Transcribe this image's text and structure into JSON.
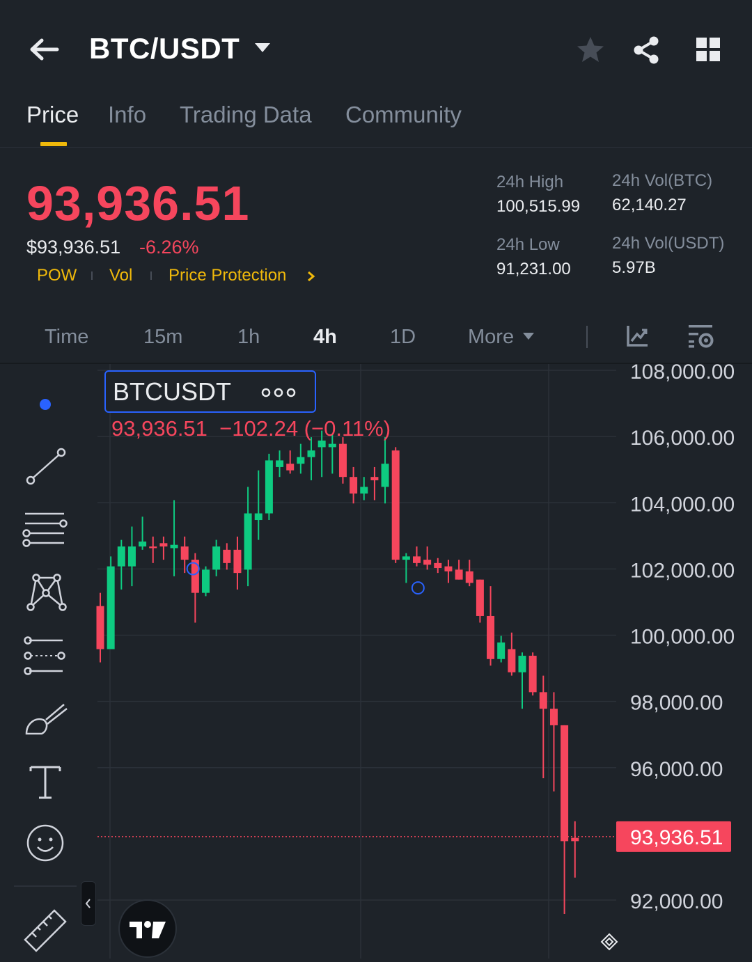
{
  "header": {
    "title": "BTC/USDT"
  },
  "tabs": [
    {
      "label": "Price",
      "active": true
    },
    {
      "label": "Info"
    },
    {
      "label": "Trading Data"
    },
    {
      "label": "Community"
    }
  ],
  "ticker": {
    "last_price": "93,936.51",
    "usd_price": "$93,936.51",
    "change_pct": "-6.26%",
    "tags": [
      "POW",
      "Vol",
      "Price Protection"
    ],
    "stats": {
      "high_label": "24h High",
      "high_value": "100,515.99",
      "low_label": "24h Low",
      "low_value": "91,231.00",
      "vol_btc_label": "24h Vol(BTC)",
      "vol_btc_value": "62,140.27",
      "vol_usdt_label": "24h Vol(USDT)",
      "vol_usdt_value": "5.97B"
    }
  },
  "intervals": [
    "Time",
    "15m",
    "1h",
    "4h",
    "1D",
    "More"
  ],
  "active_interval": "4h",
  "colors": {
    "up": "#0ecb81",
    "down": "#f6465d",
    "accent": "#f0b90b",
    "background": "#1e2329"
  },
  "icons": [
    "back-arrow-icon",
    "caret-down-icon",
    "star-icon",
    "share-icon",
    "grid-icon",
    "indicator-icon",
    "chart-settings-icon"
  ],
  "legend": {
    "symbol": "BTCUSDT",
    "ohlc": "93,936.51  −102.24 (−0.11%)"
  },
  "chart_data": {
    "type": "candlestick",
    "symbol": "BTCUSDT",
    "interval": "4h",
    "ylim": [
      91000,
      108500
    ],
    "y_ticks": [
      "108,000.00",
      "106,000.00",
      "104,000.00",
      "102,000.00",
      "100,000.00",
      "98,000.00",
      "96,000.00",
      "92,000.00"
    ],
    "last_price_label": "93,936.51",
    "last_price": 93936.51,
    "candles": [
      {
        "o": 100900,
        "h": 101300,
        "l": 99200,
        "c": 99600
      },
      {
        "o": 99600,
        "h": 102400,
        "l": 99600,
        "c": 102100
      },
      {
        "o": 102100,
        "h": 102900,
        "l": 101400,
        "c": 102700
      },
      {
        "o": 102100,
        "h": 103300,
        "l": 101500,
        "c": 102700
      },
      {
        "o": 102700,
        "h": 103600,
        "l": 102600,
        "c": 102850
      },
      {
        "o": 102700,
        "h": 103000,
        "l": 102200,
        "c": 102650
      },
      {
        "o": 102800,
        "h": 103000,
        "l": 102300,
        "c": 102700
      },
      {
        "o": 102650,
        "h": 104100,
        "l": 101800,
        "c": 102750
      },
      {
        "o": 102700,
        "h": 103000,
        "l": 101900,
        "c": 102300
      },
      {
        "o": 102300,
        "h": 102500,
        "l": 100400,
        "c": 101300
      },
      {
        "o": 101300,
        "h": 102100,
        "l": 101200,
        "c": 102000
      },
      {
        "o": 102000,
        "h": 102900,
        "l": 101800,
        "c": 102700
      },
      {
        "o": 102600,
        "h": 102800,
        "l": 102000,
        "c": 102200
      },
      {
        "o": 102600,
        "h": 103000,
        "l": 101400,
        "c": 101900
      },
      {
        "o": 102000,
        "h": 104500,
        "l": 101500,
        "c": 103700
      },
      {
        "o": 103500,
        "h": 105000,
        "l": 102900,
        "c": 103700
      },
      {
        "o": 103700,
        "h": 105500,
        "l": 103500,
        "c": 105300
      },
      {
        "o": 105100,
        "h": 105600,
        "l": 104800,
        "c": 105300
      },
      {
        "o": 105200,
        "h": 105600,
        "l": 104900,
        "c": 105000
      },
      {
        "o": 105200,
        "h": 105800,
        "l": 104900,
        "c": 105400
      },
      {
        "o": 105400,
        "h": 106000,
        "l": 104700,
        "c": 105600
      },
      {
        "o": 105700,
        "h": 106200,
        "l": 104800,
        "c": 105900
      },
      {
        "o": 105700,
        "h": 106100,
        "l": 104900,
        "c": 105800
      },
      {
        "o": 105800,
        "h": 106000,
        "l": 104600,
        "c": 104800
      },
      {
        "o": 104800,
        "h": 105100,
        "l": 104000,
        "c": 104300
      },
      {
        "o": 104300,
        "h": 104800,
        "l": 104100,
        "c": 104500
      },
      {
        "o": 104800,
        "h": 105100,
        "l": 104100,
        "c": 104700
      },
      {
        "o": 104500,
        "h": 106000,
        "l": 104000,
        "c": 105200
      },
      {
        "o": 105600,
        "h": 105700,
        "l": 102200,
        "c": 102300
      },
      {
        "o": 102300,
        "h": 102500,
        "l": 101600,
        "c": 102400
      },
      {
        "o": 102400,
        "h": 102700,
        "l": 102100,
        "c": 102200
      },
      {
        "o": 102300,
        "h": 102700,
        "l": 102000,
        "c": 102150
      },
      {
        "o": 102200,
        "h": 102350,
        "l": 101900,
        "c": 102050
      },
      {
        "o": 102100,
        "h": 102300,
        "l": 101600,
        "c": 101950
      },
      {
        "o": 102000,
        "h": 102300,
        "l": 101700,
        "c": 101700
      },
      {
        "o": 101950,
        "h": 102300,
        "l": 101500,
        "c": 101600
      },
      {
        "o": 101700,
        "h": 101700,
        "l": 100400,
        "c": 100600
      },
      {
        "o": 100600,
        "h": 101500,
        "l": 99100,
        "c": 99300
      },
      {
        "o": 99300,
        "h": 100000,
        "l": 99200,
        "c": 99800
      },
      {
        "o": 99600,
        "h": 100100,
        "l": 98800,
        "c": 98900
      },
      {
        "o": 98900,
        "h": 99500,
        "l": 97800,
        "c": 99400
      },
      {
        "o": 99400,
        "h": 99500,
        "l": 98200,
        "c": 98300
      },
      {
        "o": 98300,
        "h": 98800,
        "l": 95700,
        "c": 97800
      },
      {
        "o": 97800,
        "h": 98300,
        "l": 95300,
        "c": 97300
      },
      {
        "o": 97300,
        "h": 97300,
        "l": 91600,
        "c": 93800
      },
      {
        "o": 93900,
        "h": 94400,
        "l": 92700,
        "c": 93800
      }
    ]
  }
}
